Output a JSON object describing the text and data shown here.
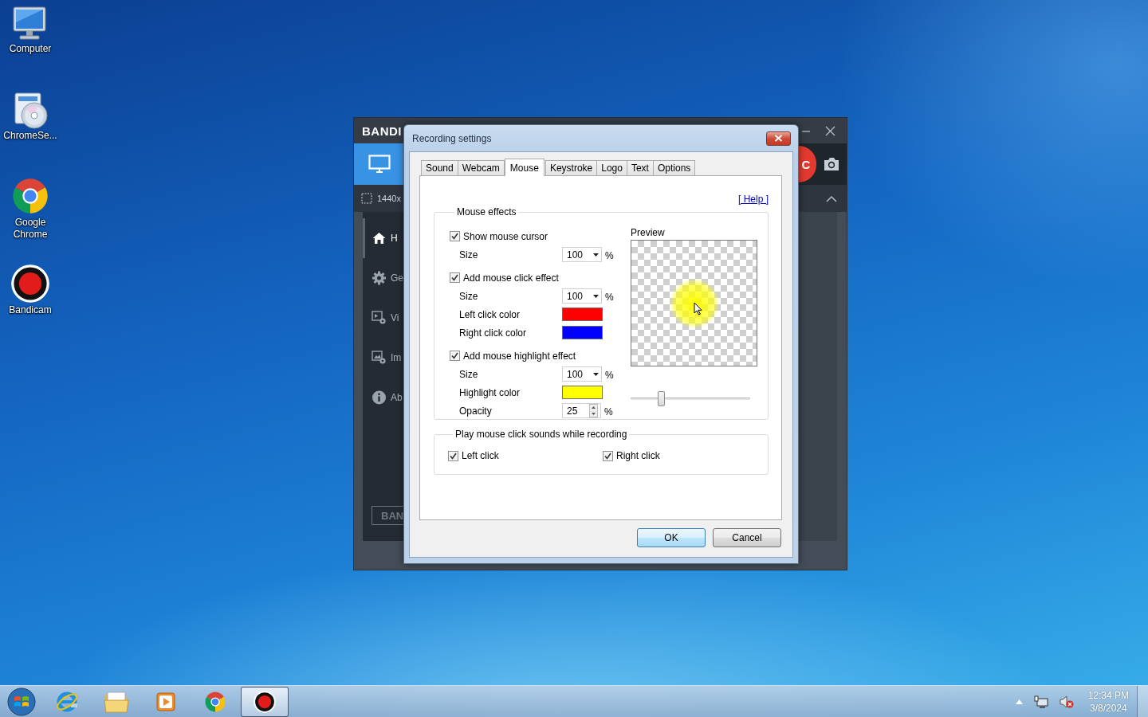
{
  "desktop_icons": [
    {
      "kind": "computer",
      "label": "Computer"
    },
    {
      "kind": "disc",
      "label": "ChromeSe..."
    },
    {
      "kind": "chrome",
      "label": "Google Chrome"
    },
    {
      "kind": "bandicam",
      "label": "Bandicam"
    }
  ],
  "bandicam": {
    "title": "BANDI",
    "capture_size": "1440x",
    "record_label": "C",
    "brand_button": "BAN",
    "sidebar": [
      {
        "kind": "home",
        "label": "H",
        "selected": true
      },
      {
        "kind": "gear",
        "label": "Ge",
        "selected": false
      },
      {
        "kind": "video",
        "label": "Vi",
        "selected": false
      },
      {
        "kind": "image",
        "label": "Im",
        "selected": false
      },
      {
        "kind": "info",
        "label": "Ab",
        "selected": false
      }
    ]
  },
  "dialog": {
    "title": "Recording settings",
    "tabs": [
      {
        "label": "Sound",
        "selected": false
      },
      {
        "label": "Webcam",
        "selected": false
      },
      {
        "label": "Mouse",
        "selected": true
      },
      {
        "label": "Keystroke",
        "selected": false
      },
      {
        "label": "Logo",
        "selected": false
      },
      {
        "label": "Text",
        "selected": false
      },
      {
        "label": "Options",
        "selected": false
      }
    ],
    "help": "[ Help ]",
    "mouse_effects": {
      "legend": "Mouse effects",
      "rows": [
        {
          "kind": "checkbox",
          "label": "Show mouse cursor",
          "checked": true
        },
        {
          "kind": "dropdown",
          "label": "Size",
          "value": "100",
          "unit": "%"
        },
        {
          "kind": "checkbox",
          "label": "Add mouse click effect",
          "checked": true
        },
        {
          "kind": "dropdown",
          "label": "Size",
          "value": "100",
          "unit": "%"
        },
        {
          "kind": "color",
          "label": "Left click color",
          "color": "#ff0000"
        },
        {
          "kind": "color",
          "label": "Right click color",
          "color": "#0000ff"
        },
        {
          "kind": "checkbox",
          "label": "Add mouse highlight effect",
          "checked": true
        },
        {
          "kind": "dropdown",
          "label": "Size",
          "value": "100",
          "unit": "%"
        },
        {
          "kind": "color",
          "label": "Highlight color",
          "color": "#ffff00"
        },
        {
          "kind": "spinner",
          "label": "Opacity",
          "value": "25",
          "unit": "%"
        }
      ],
      "preview_label": "Preview",
      "opacity_slider": {
        "level": 0.25
      }
    },
    "click_sounds": {
      "legend": "Play mouse click sounds while recording",
      "options": [
        {
          "label": "Left click",
          "checked": true
        },
        {
          "label": "Right click",
          "checked": true
        }
      ]
    },
    "buttons": [
      {
        "label": "OK",
        "default": true
      },
      {
        "label": "Cancel",
        "default": false
      }
    ]
  },
  "taskbar": {
    "apps": [
      {
        "kind": "ie",
        "active": false
      },
      {
        "kind": "folder",
        "active": false
      },
      {
        "kind": "media",
        "active": false
      },
      {
        "kind": "chrome",
        "active": false
      },
      {
        "kind": "bandicam",
        "active": true
      }
    ],
    "time": "12:34 PM",
    "date": "3/8/2024"
  }
}
